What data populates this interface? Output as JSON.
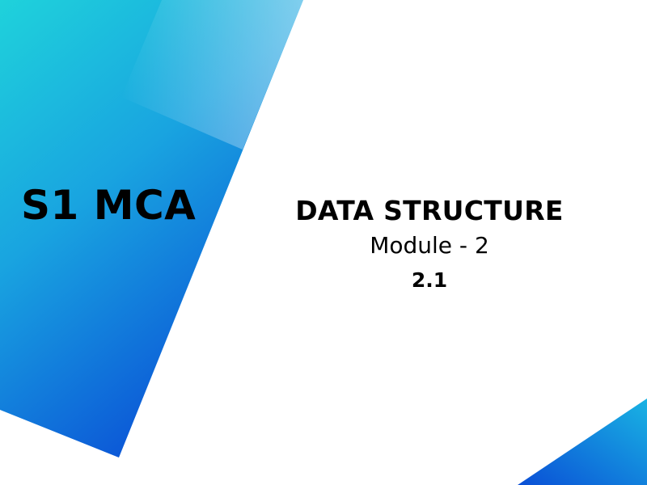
{
  "slide": {
    "course": "S1 MCA",
    "subject": "DATA STRUCTURE",
    "module": "Module - 2",
    "section": "2.1"
  },
  "colors": {
    "background": "#ffffff",
    "gradient_cyan": "#2ad4d8",
    "gradient_light": "#8fdcec",
    "gradient_blue": "#0a55d6",
    "text": "#000000"
  }
}
